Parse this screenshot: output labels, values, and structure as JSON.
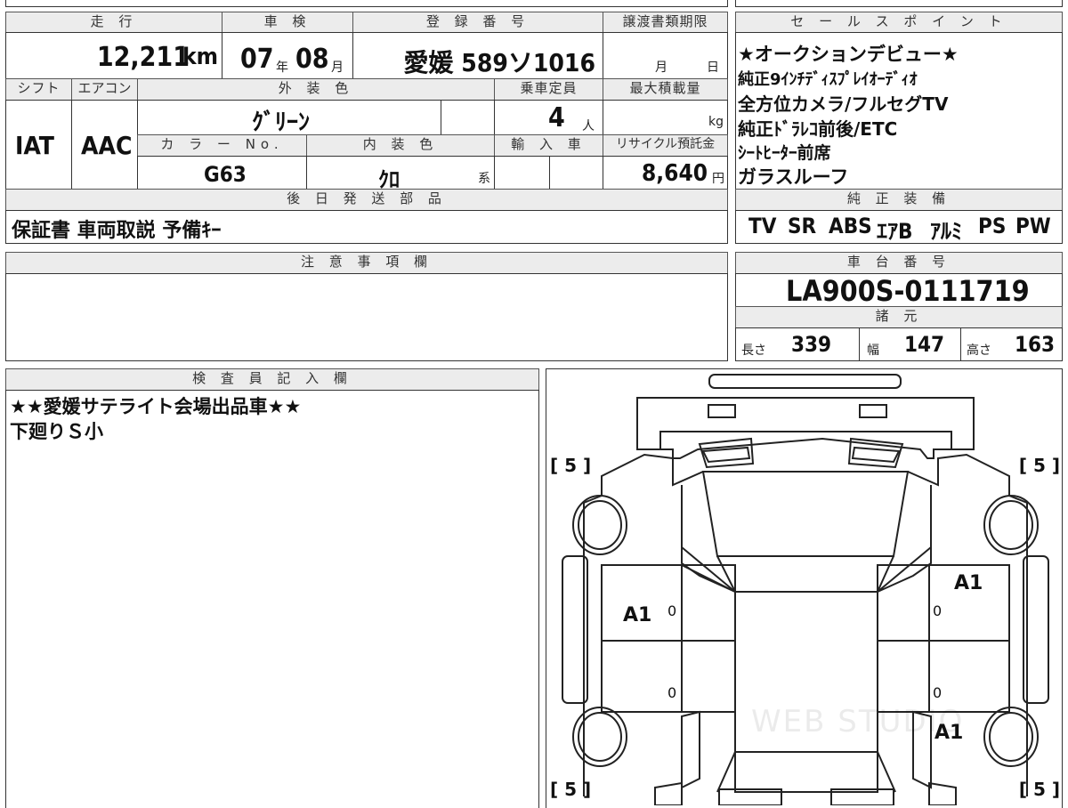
{
  "top": {
    "mileage_header": "走 行",
    "mileage_value": "12,211",
    "mileage_unit": "km",
    "inspection_header": "車 検",
    "inspection_year": "07",
    "inspection_year_unit": "年",
    "inspection_month": "08",
    "inspection_month_unit": "月",
    "reg_header": "登 録 番 号",
    "reg_value": "愛媛 589ソ1016",
    "transfer_header": "譲渡書類期限",
    "transfer_month": "月",
    "transfer_day": "日"
  },
  "row2": {
    "shift_header": "シフト",
    "shift_value": "IAT",
    "aircon_header": "エアコン",
    "aircon_value": "AAC",
    "exterior_header": "外 装 色",
    "exterior_value": "ｸﾞﾘｰﾝ",
    "capacity_header": "乗車定員",
    "capacity_value": "4",
    "capacity_unit": "人",
    "maxload_header": "最大積載量",
    "maxload_unit": "kg",
    "colorno_header": "カ ラ ー No.",
    "colorno_value": "G63",
    "interior_header": "内 装 色",
    "interior_value": "ｸﾛ",
    "interior_unit": "系",
    "import_header": "輸 入 車",
    "recycle_header": "リサイクル預託金",
    "recycle_value": "8,640",
    "recycle_unit": "円"
  },
  "later_parts": {
    "header": "後 日 発 送 部 品",
    "value": "保証書 車両取説 予備ｷｰ"
  },
  "sales_points": {
    "header": "セ ー ル ス ポ イ ン ト",
    "lines": [
      "★オークションデビュー★",
      "純正9ｲﾝﾁﾃﾞｨｽﾌﾟﾚｲｵｰﾃﾞｨｵ",
      "全方位カメラ/フルセグTV",
      "純正ﾄﾞﾗﾚｺ前後/ETC",
      "ｼｰﾄﾋｰﾀｰ前席",
      "ガラスルーフ"
    ]
  },
  "equipment": {
    "header": "純 正 装 備",
    "items": [
      "TV",
      "SR",
      "ABS",
      "ｴｱB",
      "ｱﾙﾐ",
      "PS",
      "PW"
    ]
  },
  "notes": {
    "header": "注 意 事 項 欄"
  },
  "chassis": {
    "header": "車 台 番 号",
    "value": "LA900S-0111719"
  },
  "specs": {
    "header": "諸 元",
    "length_label": "長さ",
    "length_value": "339",
    "width_label": "幅",
    "width_value": "147",
    "height_label": "高さ",
    "height_value": "163"
  },
  "inspector": {
    "header": "検 査 員 記 入 欄",
    "lines": [
      "★★愛媛サテライト会場出品車★★",
      "下廻りＳ小"
    ]
  },
  "diagram": {
    "tire_fl": "[ 5 ]",
    "tire_fr": "[ 5 ]",
    "tire_rl": "[ 5 ]",
    "tire_rr": "[ 5 ]",
    "mark_left_front_door": "A1",
    "mark_right_front_door": "A1",
    "mark_right_rear": "A1",
    "zero": "0",
    "watermark": "WEB STUDIO"
  }
}
